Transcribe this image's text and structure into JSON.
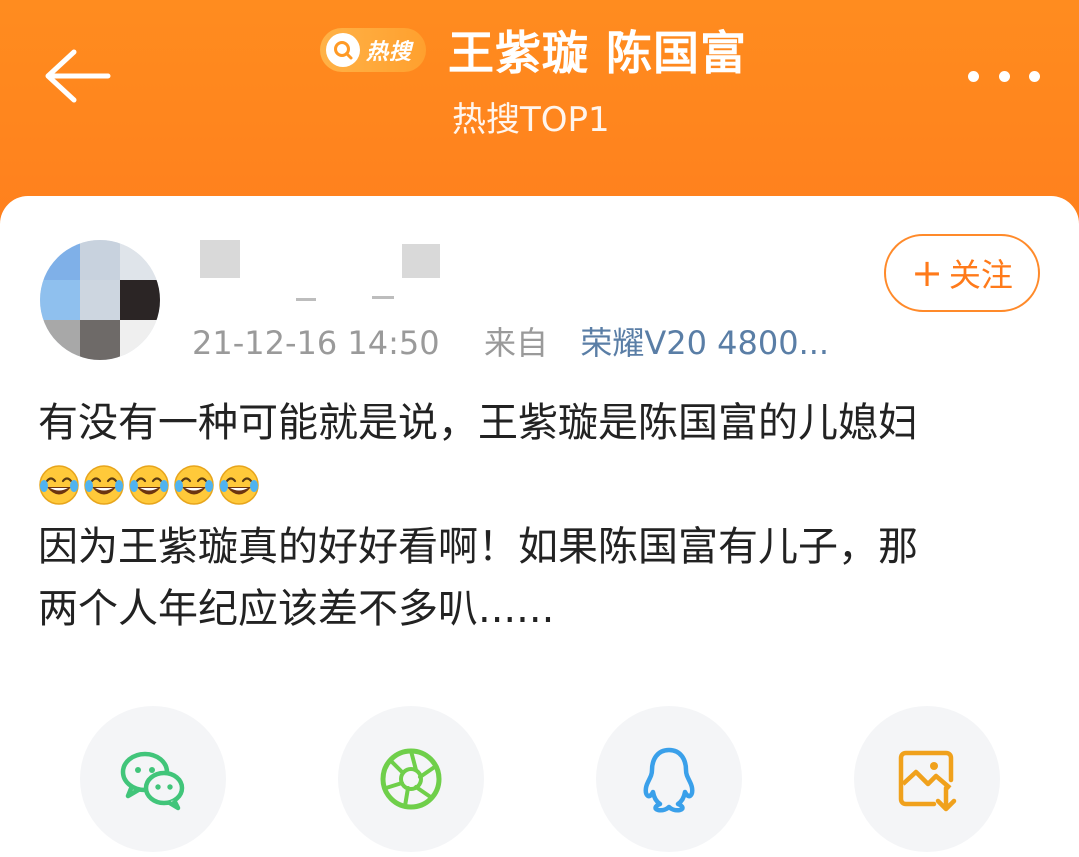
{
  "header": {
    "badge_text": "热搜",
    "title": "王紫璇 陈国富",
    "subtitle": "热搜TOP1",
    "back_icon": "back-arrow-icon",
    "more_icon": "more-dots-icon"
  },
  "post": {
    "timestamp": "21-12-16 14:50",
    "source_prefix": "来自",
    "device": "荣耀V20 4800...",
    "follow_label": "关注",
    "follow_plus": "+",
    "text_line1": "有没有一种可能就是说，王紫璇是陈国富的儿媳妇",
    "emoji_count": 5,
    "emoji_name": "laughing-tears-emoji",
    "text_line2": "因为王紫璇真的好好看啊！如果陈国富有儿子，那",
    "text_line3": "两个人年纪应该差不多叭......"
  },
  "share": {
    "items": [
      {
        "icon": "wechat-icon",
        "color": "#41c57a"
      },
      {
        "icon": "moments-icon",
        "color": "#6fcf4a"
      },
      {
        "icon": "qq-icon",
        "color": "#3aa0ea"
      },
      {
        "icon": "save-image-icon",
        "color": "#f0a11c"
      }
    ]
  },
  "colors": {
    "header_orange": "#ff7a1a",
    "follow_orange": "#ff7a1a",
    "link_blue": "#5a7ea6",
    "meta_gray": "#9a9a9a"
  }
}
